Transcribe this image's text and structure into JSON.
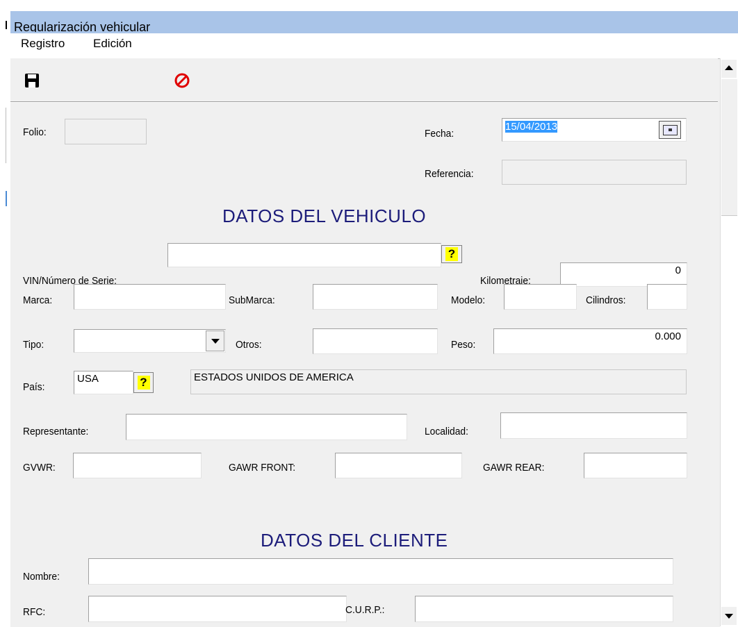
{
  "window": {
    "title": "Regularización vehicular"
  },
  "menu": [
    {
      "label": "Registro"
    },
    {
      "label": "Edición"
    }
  ],
  "toolbar": {
    "save_icon": "floppy-disk-icon",
    "cancel_icon": "cancel-icon",
    "cancel_color": "#e00000"
  },
  "header": {
    "folio_label": "Folio:",
    "folio_value": "",
    "fecha_label": "Fecha:",
    "fecha_value": "15/04/2013",
    "referencia_label": "Referencia:",
    "referencia_value": ""
  },
  "vehicle": {
    "heading": "DATOS DEL VEHICULO",
    "vin_label": "VIN/Número de Serie:",
    "vin_value": "",
    "km_label": "Kilometraje:",
    "km_value": "0",
    "marca_label": "Marca:",
    "marca_value": "",
    "submarca_label": "SubMarca:",
    "submarca_value": "",
    "modelo_label": "Modelo:",
    "modelo_value": "",
    "cilindros_label": "Cilindros:",
    "cilindros_value": "",
    "tipo_label": "Tipo:",
    "tipo_value": "",
    "otros_label": "Otros:",
    "otros_value": "",
    "peso_label": "Peso:",
    "peso_value": "0.000",
    "pais_label": "País:",
    "pais_code": "USA",
    "pais_name": "ESTADOS UNIDOS DE AMERICA",
    "representante_label": "Representante:",
    "representante_value": "",
    "localidad_label": "Localidad:",
    "localidad_value": "",
    "gvwr_label": "GVWR:",
    "gvwr_value": "",
    "gawr_front_label": "GAWR FRONT:",
    "gawr_front_value": "",
    "gawr_rear_label": "GAWR REAR:",
    "gawr_rear_value": "",
    "lookup_symbol": "?"
  },
  "client": {
    "heading": "DATOS DEL CLIENTE",
    "nombre_label": "Nombre:",
    "nombre_value": "",
    "rfc_label": "RFC:",
    "rfc_value": "",
    "curp_label": "C.U.R.P.:",
    "curp_value": ""
  },
  "colors": {
    "titlebar": "#a9c4e8",
    "heading": "#1c1c7a",
    "selection": "#3399ff"
  }
}
